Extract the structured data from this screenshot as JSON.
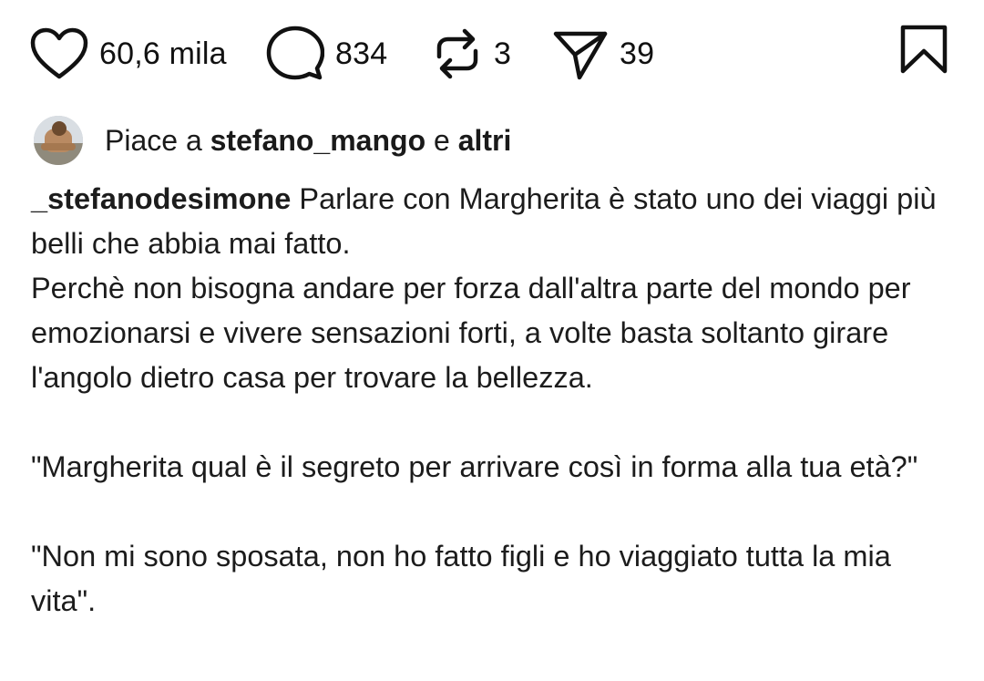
{
  "actions": {
    "like_count": "60,6 mila",
    "comment_count": "834",
    "repost_count": "3",
    "share_count": "39",
    "icons": [
      "heart-icon",
      "comment-bubble-icon",
      "repost-icon",
      "send-icon",
      "bookmark-icon"
    ]
  },
  "likes": {
    "prefix": "Piace a",
    "user": "stefano_mango",
    "conjunction": "e",
    "others": "altri"
  },
  "caption": {
    "username": "_stefanodesimone",
    "line1": "Parlare con Margherita è stato uno dei viaggi più belli che abbia mai fatto.",
    "line2": "Perchè non bisogna andare per forza dall'altra parte del mondo per emozionarsi e vivere sensazioni forti, a volte basta soltanto girare l'angolo dietro casa per trovare la bellezza.",
    "quote1": "\"Margherita qual è il segreto per arrivare così in forma alla tua età?\"",
    "quote2": "\"Non mi sono sposata, non ho fatto figli e ho viaggiato tutta la mia vita\"."
  },
  "colors": {
    "text": "#0a0a0a",
    "background": "#ffffff"
  }
}
